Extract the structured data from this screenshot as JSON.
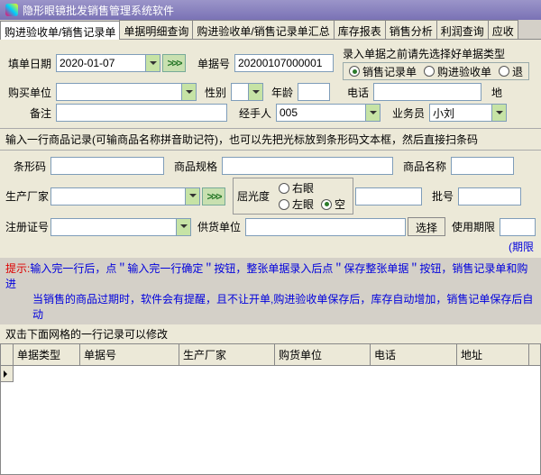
{
  "window": {
    "title": "隐形眼镜批发销售管理系统软件"
  },
  "tabs": {
    "items": [
      "购进验收单/销售记录单",
      "单据明细查询",
      "购进验收单/销售记录单汇总",
      "库存报表",
      "销售分析",
      "利润查询",
      "应收"
    ],
    "active": 0
  },
  "form": {
    "fill_date_label": "填单日期",
    "fill_date_value": "2020-01-07",
    "doc_no_label": "单据号",
    "doc_no_value": "20200107000001",
    "type_hint": "录入单据之前请先选择好单据类型",
    "type_options": {
      "sale": "销售记录单",
      "purchase": "购进验收单",
      "return": "退"
    },
    "type_selected": "sale",
    "buyer_label": "购买单位",
    "gender_label": "性别",
    "age_label": "年龄",
    "phone_label": "电话",
    "addr_label": "地",
    "remark_label": "备注",
    "handler_label": "经手人",
    "handler_value": "005",
    "sales_label": "业务员",
    "sales_value": "小刘"
  },
  "goods": {
    "hint": "输入一行商品记录(可输商品名称拼音助记符)，也可以先把光标放到条形码文本框，然后直接扫条码",
    "barcode_label": "条形码",
    "spec_label": "商品规格",
    "name_label": "商品名称",
    "maker_label": "生产厂家",
    "diopter_label": "屈光度",
    "diopter_right": "右眼",
    "diopter_left": "左眼",
    "diopter_none": "空",
    "diopter_selected": "none",
    "batch_label": "批号",
    "reg_label": "注册证号",
    "supplier_label": "供货单位",
    "select_btn": "选择",
    "expiry_label": "使用期限",
    "expiry_note": "(期限"
  },
  "hints": {
    "prefix": "提示:",
    "line1a": "输入完一行后，点＂输入完一行确定＂按钮，整张单据录入后点＂保存整张单据＂按钮，销售记录单和购进",
    "line2": "当销售的商品过期时，软件会有提醒，且不让开单,购进验收单保存后，库存自动增加，销售记单保存后自动"
  },
  "grid": {
    "edit_hint": "双击下面网格的一行记录可以修改",
    "cols": [
      "单据类型",
      "单据号",
      "生产厂家",
      "购货单位",
      "电话",
      "地址"
    ]
  }
}
